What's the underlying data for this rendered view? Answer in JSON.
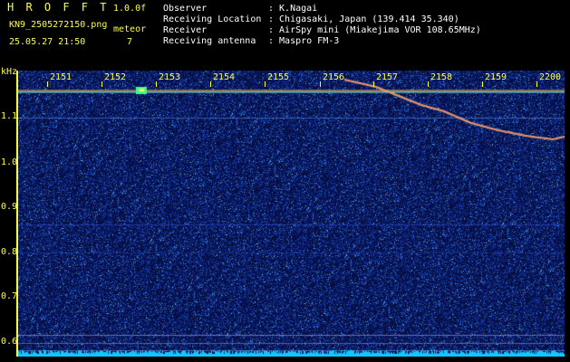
{
  "header": {
    "app": "H R O F F T",
    "version": "1.0.0f",
    "filename": "KN9_2505272150.png",
    "mode": "meteor",
    "datetime": "25.05.27 21:50",
    "count": "7",
    "info": [
      {
        "label": "Observer",
        "value": ": K.Nagai"
      },
      {
        "label": "Receiving Location",
        "value": ": Chigasaki, Japan (139.414 35.340)"
      },
      {
        "label": "Receiver",
        "value": ": AirSpy mini (Miakejima VOR 108.65MHz)"
      },
      {
        "label": "Receiving antenna",
        "value": ": Maspro FM-3"
      }
    ]
  },
  "axis": {
    "unit": "kHz",
    "yticks": [
      "1.1",
      "1.0",
      "0.9",
      "0.8",
      "0.7",
      "0.6"
    ],
    "times": [
      "2151",
      "2152",
      "2153",
      "2154",
      "2155",
      "2156",
      "2157",
      "2158",
      "2159",
      "2200"
    ]
  },
  "colors": {
    "background": "#061040",
    "text": "#ffff40",
    "carrier": "#ff4060",
    "floor": "#10c8ff"
  }
}
